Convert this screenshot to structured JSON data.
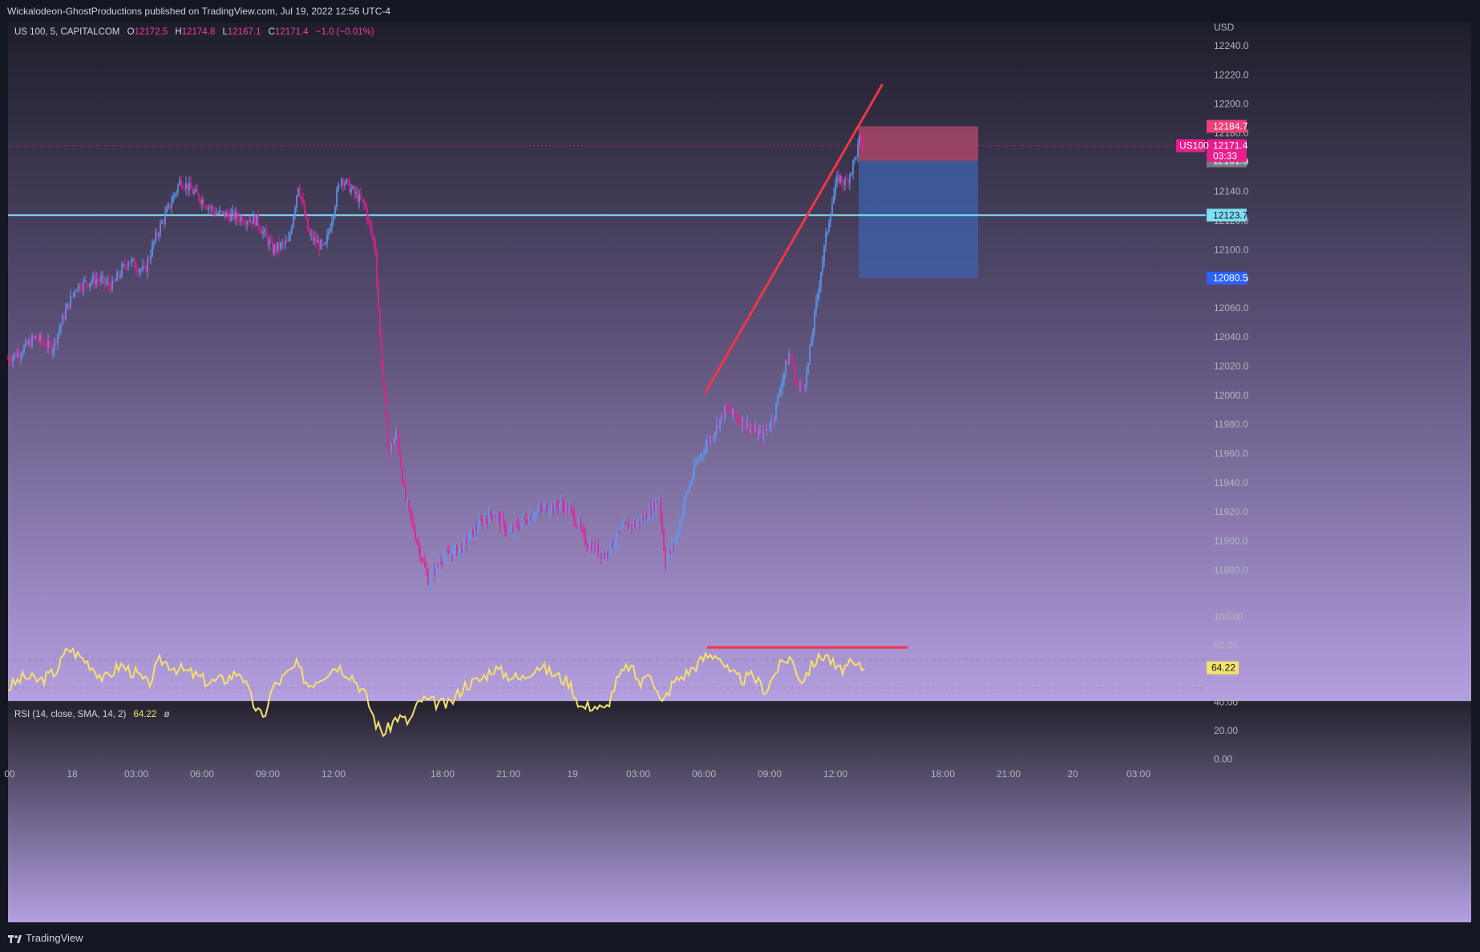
{
  "header": {
    "published": "Wickalodeon-GhostProductions published on TradingView.com, Jul 19, 2022 12:56 UTC-4"
  },
  "legend": {
    "symbol": "US 100, 5, CAPITALCOM",
    "open_label": "O",
    "open": "12172.5",
    "high_label": "H",
    "high": "12174.8",
    "low_label": "L",
    "low": "12167.1",
    "close_label": "C",
    "close": "12171.4",
    "change": "−1.0 (−0.01%)"
  },
  "rsi_legend": {
    "label": "RSI (14, close, SMA, 14, 2)",
    "value": "64.22",
    "extra": "ø"
  },
  "footer": {
    "brand": "TradingView"
  },
  "colors": {
    "bull": "#5b9cf6",
    "bear": "#e91e8c",
    "rsi_line": "#f5e16b",
    "trendline": "#f23645",
    "support": "#7ddff0",
    "stop_zone": "#b84a6e",
    "target_zone": "#3f5fa8",
    "bg_top": "#1e1e2a",
    "bg_bottom": "#b49fe0"
  },
  "chart_data": [
    {
      "type": "candlestick",
      "title": "US 100, 5, CAPITALCOM",
      "currency": "USD",
      "ylim": [
        11865,
        12245
      ],
      "y_ticks": [
        11880,
        11900,
        11920,
        11940,
        11960,
        11980,
        12000,
        12020,
        12040,
        12060,
        12080,
        12100,
        12120,
        12140,
        12160,
        12180,
        12200,
        12220,
        12240
      ],
      "x_tick_labels": [
        "00",
        "18",
        "03:00",
        "06:00",
        "09:00",
        "12:00",
        "18:00",
        "21:00",
        "19",
        "03:00",
        "06:00",
        "09:00",
        "12:00",
        "18:00",
        "21:00",
        "20",
        "03:00"
      ],
      "price_path": [
        [
          0,
          12025
        ],
        [
          15,
          12030
        ],
        [
          35,
          12040
        ],
        [
          55,
          12032
        ],
        [
          70,
          12055
        ],
        [
          85,
          12075
        ],
        [
          110,
          12080
        ],
        [
          130,
          12075
        ],
        [
          150,
          12093
        ],
        [
          170,
          12085
        ],
        [
          185,
          12110
        ],
        [
          200,
          12128
        ],
        [
          215,
          12148
        ],
        [
          230,
          12140
        ],
        [
          260,
          12125
        ],
        [
          290,
          12122
        ],
        [
          310,
          12120
        ],
        [
          330,
          12100
        ],
        [
          350,
          12105
        ],
        [
          362,
          12145
        ],
        [
          375,
          12110
        ],
        [
          395,
          12100
        ],
        [
          415,
          12150
        ],
        [
          430,
          12140
        ],
        [
          445,
          12130
        ],
        [
          458,
          12100
        ],
        [
          465,
          12030
        ],
        [
          475,
          11960
        ],
        [
          485,
          11975
        ],
        [
          495,
          11930
        ],
        [
          505,
          11910
        ],
        [
          515,
          11890
        ],
        [
          525,
          11872
        ],
        [
          540,
          11888
        ],
        [
          565,
          11895
        ],
        [
          585,
          11910
        ],
        [
          605,
          11920
        ],
        [
          625,
          11905
        ],
        [
          645,
          11915
        ],
        [
          670,
          11923
        ],
        [
          690,
          11925
        ],
        [
          705,
          11918
        ],
        [
          720,
          11900
        ],
        [
          745,
          11890
        ],
        [
          765,
          11908
        ],
        [
          785,
          11912
        ],
        [
          800,
          11920
        ],
        [
          812,
          11930
        ],
        [
          820,
          11885
        ],
        [
          832,
          11900
        ],
        [
          845,
          11930
        ],
        [
          860,
          11955
        ],
        [
          880,
          11975
        ],
        [
          895,
          11990
        ],
        [
          910,
          11985
        ],
        [
          925,
          11978
        ],
        [
          940,
          11972
        ],
        [
          955,
          11985
        ],
        [
          965,
          12010
        ],
        [
          975,
          12030
        ],
        [
          985,
          12005
        ],
        [
          995,
          12010
        ],
        [
          1005,
          12050
        ],
        [
          1015,
          12090
        ],
        [
          1025,
          12125
        ],
        [
          1035,
          12150
        ],
        [
          1045,
          12145
        ],
        [
          1055,
          12160
        ],
        [
          1062,
          12175
        ],
        [
          1068,
          12171
        ]
      ],
      "levels": [
        {
          "name": "stop",
          "value": 12184.7,
          "label": "12184.7",
          "color": "#ec407a"
        },
        {
          "name": "last_price",
          "value": 12171.4,
          "label": "12171.4",
          "symbol_tag": "US100",
          "countdown": "03:33",
          "color": "#e91e8c"
        },
        {
          "name": "entry",
          "value": 12161.0,
          "label": "12161.0",
          "color": "#787b86"
        },
        {
          "name": "support",
          "value": 12123.7,
          "label": "12123.7",
          "color": "#7ddff0"
        },
        {
          "name": "target",
          "value": 12080.5,
          "label": "12080.5",
          "color": "#2962ff"
        }
      ],
      "position_tool": {
        "type": "short",
        "entry": 12161.0,
        "stop": 12184.7,
        "target": 12080.5
      },
      "trendline": {
        "from": [
          870,
          12002
        ],
        "to": [
          1090,
          12213
        ]
      }
    },
    {
      "type": "line",
      "title": "RSI (14, close, SMA, 14, 2)",
      "ylim": [
        -3,
        104
      ],
      "y_ticks": [
        0,
        20,
        40,
        60,
        80,
        100
      ],
      "y_tick_labels": [
        "0.00",
        "20.00",
        "40.00",
        "60.00",
        "80.00",
        "100.00"
      ],
      "bands": [
        70,
        50
      ],
      "current": 64.22,
      "x": [
        0,
        20,
        40,
        60,
        75,
        85,
        100,
        120,
        140,
        160,
        175,
        190,
        210,
        230,
        250,
        270,
        290,
        305,
        318,
        330,
        345,
        360,
        375,
        390,
        410,
        430,
        445,
        460,
        470,
        485,
        500,
        515,
        530,
        550,
        570,
        590,
        605,
        620,
        640,
        660,
        680,
        700,
        715,
        730,
        745,
        760,
        775,
        790,
        800,
        815,
        830,
        850,
        870,
        885,
        900,
        915,
        930,
        945,
        960,
        975,
        990,
        1005,
        1020,
        1035,
        1050,
        1068
      ],
      "values": [
        50,
        58,
        55,
        62,
        78,
        74,
        68,
        56,
        66,
        60,
        52,
        70,
        64,
        60,
        54,
        56,
        62,
        40,
        28,
        50,
        58,
        66,
        52,
        58,
        66,
        58,
        46,
        24,
        18,
        30,
        26,
        42,
        40,
        38,
        52,
        56,
        64,
        60,
        56,
        66,
        60,
        54,
        36,
        38,
        34,
        56,
        66,
        52,
        64,
        38,
        54,
        62,
        72,
        74,
        60,
        56,
        58,
        48,
        64,
        72,
        55,
        68,
        74,
        62,
        66,
        64
      ],
      "divergence_line": {
        "from": [
          872,
          78.5
        ],
        "to": [
          1122,
          78.5
        ]
      }
    }
  ]
}
